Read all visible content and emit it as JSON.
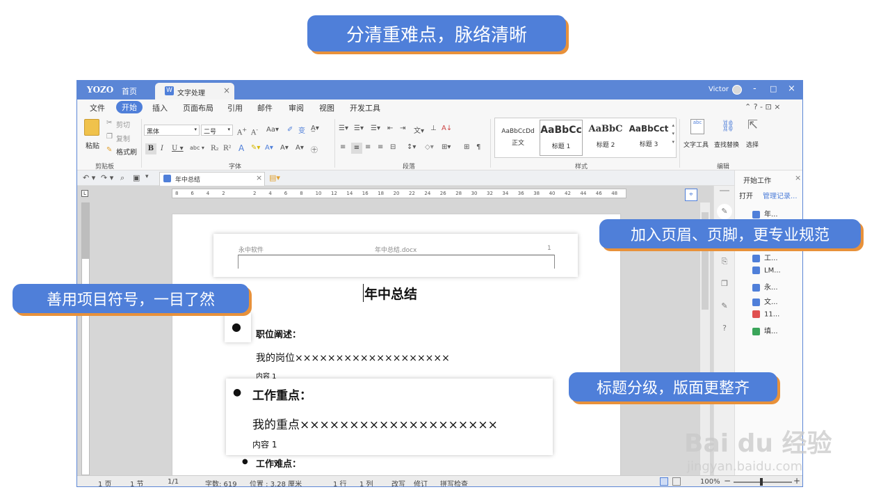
{
  "callouts": {
    "top": "分清重难点，脉络清晰",
    "right": "加入页眉、页脚，更专业规范",
    "left": "善用项目符号，一目了然",
    "bottom_right": "标题分级，版面更整齐"
  },
  "titlebar": {
    "logo": "YOZO",
    "home": "首页",
    "tab_label": "文字处理",
    "tab_close": "×",
    "user": "Victor",
    "minimize": "-",
    "maximize": "□",
    "close": "×"
  },
  "menu": {
    "items": [
      "文件",
      "开始",
      "插入",
      "页面布局",
      "引用",
      "邮件",
      "审阅",
      "视图",
      "开发工具"
    ],
    "active_index": 1,
    "right_controls": "⌃ ? - ⊡ ×"
  },
  "ribbon": {
    "clipboard": {
      "paste": "粘贴",
      "cut": "剪切",
      "copy": "复制",
      "format_painter": "格式刷",
      "label": "剪贴板"
    },
    "font": {
      "family": "黑体",
      "size": "二号",
      "label": "字体"
    },
    "paragraph": {
      "label": "段落"
    },
    "styles": {
      "label": "样式",
      "items": [
        {
          "sample": "AaBbCcDd",
          "name": "正文"
        },
        {
          "sample": "AaBbCc",
          "name": "标题 1"
        },
        {
          "sample": "AaBbC",
          "name": "标题 2"
        },
        {
          "sample": "AaBbCct",
          "name": "标题 3"
        }
      ]
    },
    "editing": {
      "text_tool": "文字工具",
      "find_replace": "查找替换",
      "select": "选择",
      "label": "编辑"
    }
  },
  "quickbar": {
    "doc_tab": "年中总结",
    "close": "×"
  },
  "ruler": {
    "numbers": [
      "8",
      "6",
      "4",
      "2",
      "",
      "2",
      "4",
      "6",
      "8",
      "10",
      "12",
      "14",
      "16",
      "18",
      "20",
      "22",
      "24",
      "26",
      "28",
      "30",
      "32",
      "34",
      "36",
      "38",
      "40",
      "42",
      "44",
      "46",
      "48"
    ]
  },
  "document": {
    "header_left": "永中软件",
    "header_center": "年中总结.docx",
    "header_right": "1",
    "title": "年中总结",
    "section1_heading": "职位阐述：",
    "section1_body": "我的岗位×××××××××××××××××××",
    "section1_content": "内容 1",
    "section2_heading": "工作重点：",
    "section2_body": "我的重点××××××××××××××××××××",
    "section2_content": "内容 1",
    "section3_heading": "工作难点："
  },
  "sidebar": {
    "title": "开始工作",
    "open": "打开",
    "manage": "管理记录...",
    "files": [
      {
        "name": "年...",
        "color": "#4f7fd9"
      },
      {
        "name": "工...",
        "color": "#4f7fd9"
      },
      {
        "name": "LM...",
        "color": "#4f7fd9"
      },
      {
        "name": "永...",
        "color": "#4f7fd9"
      },
      {
        "name": "文...",
        "color": "#4f7fd9"
      },
      {
        "name": "11...",
        "color": "#e05050"
      },
      {
        "name": "填...",
        "color": "#3aa55a"
      }
    ]
  },
  "status": {
    "page": "1 页",
    "section": "1 节",
    "pages": "1/1",
    "words": "字数: 619",
    "position": "位置 : 3.28 厘米",
    "row": "1 行",
    "col": "1 列",
    "overwrite": "改写",
    "revise": "修订",
    "spell": "拼写检查",
    "zoom": "100%"
  },
  "watermark": {
    "brand": "Bai du 经验",
    "url": "jingyan.baidu.com"
  },
  "colors": {
    "accent": "#4f7fd9",
    "shadow": "#e8913a",
    "titlebar": "#5b86d6"
  }
}
